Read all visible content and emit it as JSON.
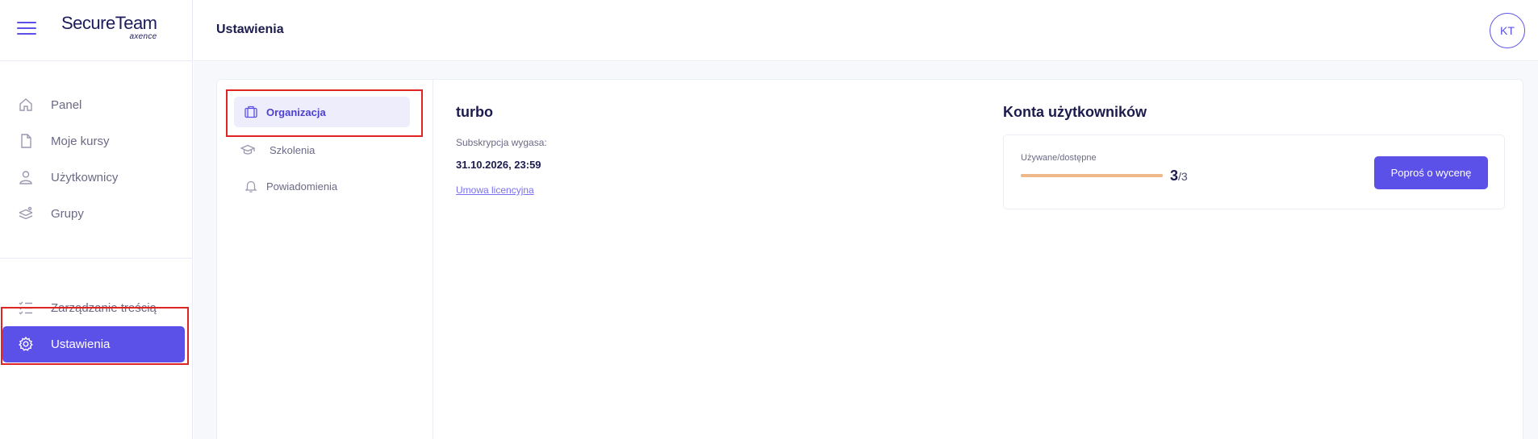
{
  "brand": {
    "name": "SecureTeam",
    "sub": "axence",
    "accent": "#5b50e8"
  },
  "sidebar": {
    "primary": [
      {
        "label": "Panel",
        "icon": "home-icon"
      },
      {
        "label": "Moje kursy",
        "icon": "document-icon"
      },
      {
        "label": "Użytkownicy",
        "icon": "user-icon"
      },
      {
        "label": "Grupy",
        "icon": "layers-icon"
      }
    ],
    "secondary": [
      {
        "label": "Zarządzanie treścią",
        "icon": "checklist-icon"
      },
      {
        "label": "Ustawienia",
        "icon": "gear-icon",
        "active": true
      }
    ]
  },
  "header": {
    "title": "Ustawienia",
    "avatar_initials": "KT"
  },
  "settings_nav": [
    {
      "label": "Organizacja",
      "icon": "briefcase-icon",
      "active": true
    },
    {
      "label": "Szkolenia",
      "icon": "graduation-cap-icon"
    },
    {
      "label": "Powiadomienia",
      "icon": "bell-icon"
    }
  ],
  "organization": {
    "name": "turbo",
    "subscription_label": "Subskrypcja wygasa:",
    "subscription_date": "31.10.2026, 23:59",
    "license_link": "Umowa licencyjna"
  },
  "accounts": {
    "title": "Konta użytkowników",
    "usage_label": "Używane/dostępne",
    "used": "3",
    "total": "/3",
    "usage_fraction": 1.0,
    "quote_button": "Poproś o wycenę"
  }
}
